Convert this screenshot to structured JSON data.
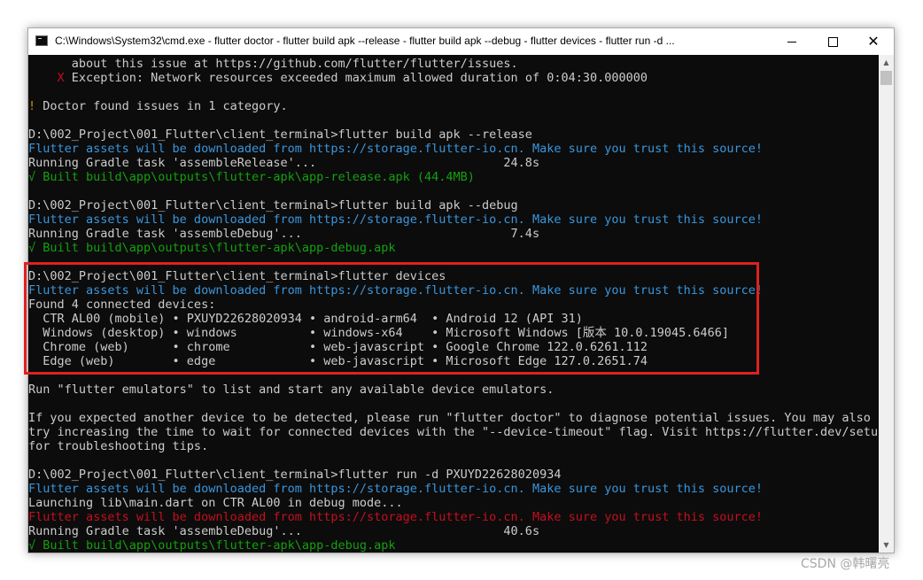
{
  "window": {
    "title": "C:\\Windows\\System32\\cmd.exe - flutter  doctor - flutter  build apk --release - flutter  build apk --debug - flutter  devices - flutter  run -d ...",
    "minimize_label": "minimize",
    "maximize_label": "maximize",
    "close_glyph": "✕"
  },
  "colors": {
    "background": "#0c0c0c",
    "text": "#cccccc",
    "cyan": "#3a96dd",
    "green": "#13a10e",
    "red": "#c50f1f",
    "yellow": "#c19c00",
    "highlight": "#e02020"
  },
  "console": {
    "lines": [
      {
        "segments": [
          {
            "text": "      about this issue at https://github.com/flutter/flutter/issues.",
            "color": "white"
          }
        ]
      },
      {
        "segments": [
          {
            "text": "    X",
            "color": "red"
          },
          {
            "text": " Exception: Network resources exceeded maximum allowed duration of 0:04:30.000000",
            "color": "white"
          }
        ]
      },
      {
        "segments": [
          {
            "text": "",
            "color": "white"
          }
        ]
      },
      {
        "segments": [
          {
            "text": "!",
            "color": "yellow"
          },
          {
            "text": " Doctor found issues in 1 category.",
            "color": "white"
          }
        ]
      },
      {
        "segments": [
          {
            "text": "",
            "color": "white"
          }
        ]
      },
      {
        "segments": [
          {
            "text": "D:\\002_Project\\001_Flutter\\client_terminal>flutter build apk --release",
            "color": "white"
          }
        ]
      },
      {
        "segments": [
          {
            "text": "Flutter assets will be downloaded from https://storage.flutter-io.cn. Make sure you trust this source!",
            "color": "cyan"
          }
        ]
      },
      {
        "segments": [
          {
            "text": "Running Gradle task 'assembleRelease'...                          24.8s",
            "color": "white"
          }
        ]
      },
      {
        "segments": [
          {
            "text": "√ Built build\\app\\outputs\\flutter-apk\\app-release.apk (44.4MB)",
            "color": "green"
          }
        ]
      },
      {
        "segments": [
          {
            "text": "",
            "color": "white"
          }
        ]
      },
      {
        "segments": [
          {
            "text": "D:\\002_Project\\001_Flutter\\client_terminal>flutter build apk --debug",
            "color": "white"
          }
        ]
      },
      {
        "segments": [
          {
            "text": "Flutter assets will be downloaded from https://storage.flutter-io.cn. Make sure you trust this source!",
            "color": "cyan"
          }
        ]
      },
      {
        "segments": [
          {
            "text": "Running Gradle task 'assembleDebug'...                             7.4s",
            "color": "white"
          }
        ]
      },
      {
        "segments": [
          {
            "text": "√ Built build\\app\\outputs\\flutter-apk\\app-debug.apk",
            "color": "green"
          }
        ]
      },
      {
        "segments": [
          {
            "text": "",
            "color": "white"
          }
        ]
      },
      {
        "segments": [
          {
            "text": "D:\\002_Project\\001_Flutter\\client_terminal>flutter devices",
            "color": "white"
          }
        ]
      },
      {
        "segments": [
          {
            "text": "Flutter assets will be downloaded from https://storage.flutter-io.cn. Make sure you trust this source!",
            "color": "cyan"
          }
        ]
      },
      {
        "segments": [
          {
            "text": "Found 4 connected devices:",
            "color": "white"
          }
        ]
      },
      {
        "segments": [
          {
            "text": "  CTR AL00 (mobile) • PXUYD22628020934 • android-arm64  • Android 12 (API 31)",
            "color": "white"
          }
        ]
      },
      {
        "segments": [
          {
            "text": "  Windows (desktop) • windows          • windows-x64    • Microsoft Windows [版本 10.0.19045.6466]",
            "color": "white"
          }
        ]
      },
      {
        "segments": [
          {
            "text": "  Chrome (web)      • chrome           • web-javascript • Google Chrome 122.0.6261.112",
            "color": "white"
          }
        ]
      },
      {
        "segments": [
          {
            "text": "  Edge (web)        • edge             • web-javascript • Microsoft Edge 127.0.2651.74",
            "color": "white"
          }
        ]
      },
      {
        "segments": [
          {
            "text": "",
            "color": "white"
          }
        ]
      },
      {
        "segments": [
          {
            "text": "Run \"flutter emulators\" to list and start any available device emulators.",
            "color": "white"
          }
        ]
      },
      {
        "segments": [
          {
            "text": "",
            "color": "white"
          }
        ]
      },
      {
        "segments": [
          {
            "text": "If you expected another device to be detected, please run \"flutter doctor\" to diagnose potential issues. You may also",
            "color": "white"
          }
        ]
      },
      {
        "segments": [
          {
            "text": "try increasing the time to wait for connected devices with the \"--device-timeout\" flag. Visit https://flutter.dev/setup/",
            "color": "white"
          }
        ]
      },
      {
        "segments": [
          {
            "text": "for troubleshooting tips.",
            "color": "white"
          }
        ]
      },
      {
        "segments": [
          {
            "text": "",
            "color": "white"
          }
        ]
      },
      {
        "segments": [
          {
            "text": "D:\\002_Project\\001_Flutter\\client_terminal>flutter run -d PXUYD22628020934",
            "color": "white"
          }
        ]
      },
      {
        "segments": [
          {
            "text": "Flutter assets will be downloaded from https://storage.flutter-io.cn. Make sure you trust this source!",
            "color": "cyan"
          }
        ]
      },
      {
        "segments": [
          {
            "text": "Launching lib\\main.dart on CTR AL00 in debug mode...",
            "color": "white"
          }
        ]
      },
      {
        "segments": [
          {
            "text": "Flutter assets will be downloaded from https://storage.flutter-io.cn. Make sure you trust this source!",
            "color": "red"
          }
        ]
      },
      {
        "segments": [
          {
            "text": "Running Gradle task 'assembleDebug'...                            40.6s",
            "color": "white"
          }
        ]
      },
      {
        "segments": [
          {
            "text": "√ Built build\\app\\outputs\\flutter-apk\\app-debug.apk",
            "color": "green"
          }
        ]
      }
    ]
  },
  "watermark": "CSDN @韩曙亮"
}
